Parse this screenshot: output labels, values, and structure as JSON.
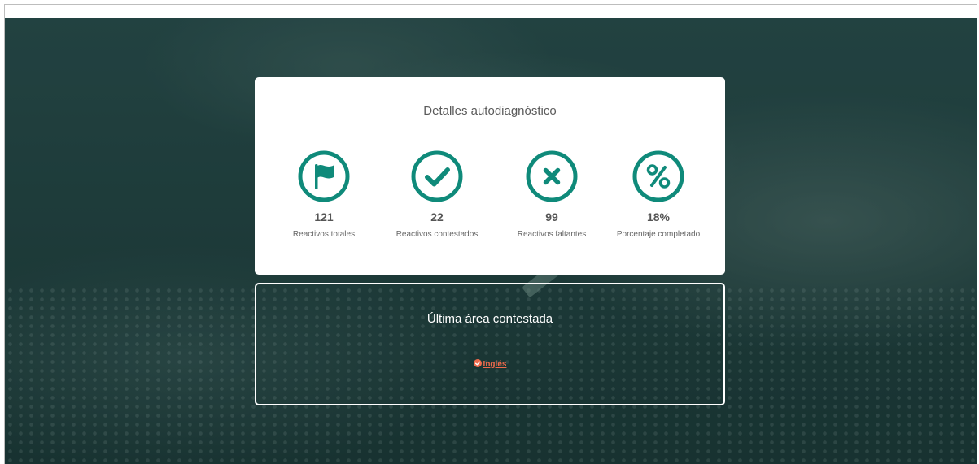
{
  "details": {
    "title": "Detalles autodiagnóstico",
    "stats": [
      {
        "icon": "flag-icon",
        "value": "121",
        "label": "Reactivos totales"
      },
      {
        "icon": "check-icon",
        "value": "22",
        "label": "Reactivos contestados"
      },
      {
        "icon": "x-icon",
        "value": "99",
        "label": "Reactivos faltantes"
      },
      {
        "icon": "percent-icon",
        "value": "18%",
        "label": "Porcentaje completado"
      }
    ]
  },
  "last_area": {
    "title": "Última área contestada",
    "subject": "Inglés",
    "subject_icon": "check-circle-icon"
  },
  "colors": {
    "accent": "#0f8a7a",
    "link": "#ef6a4c",
    "card_bg": "#ffffff"
  }
}
